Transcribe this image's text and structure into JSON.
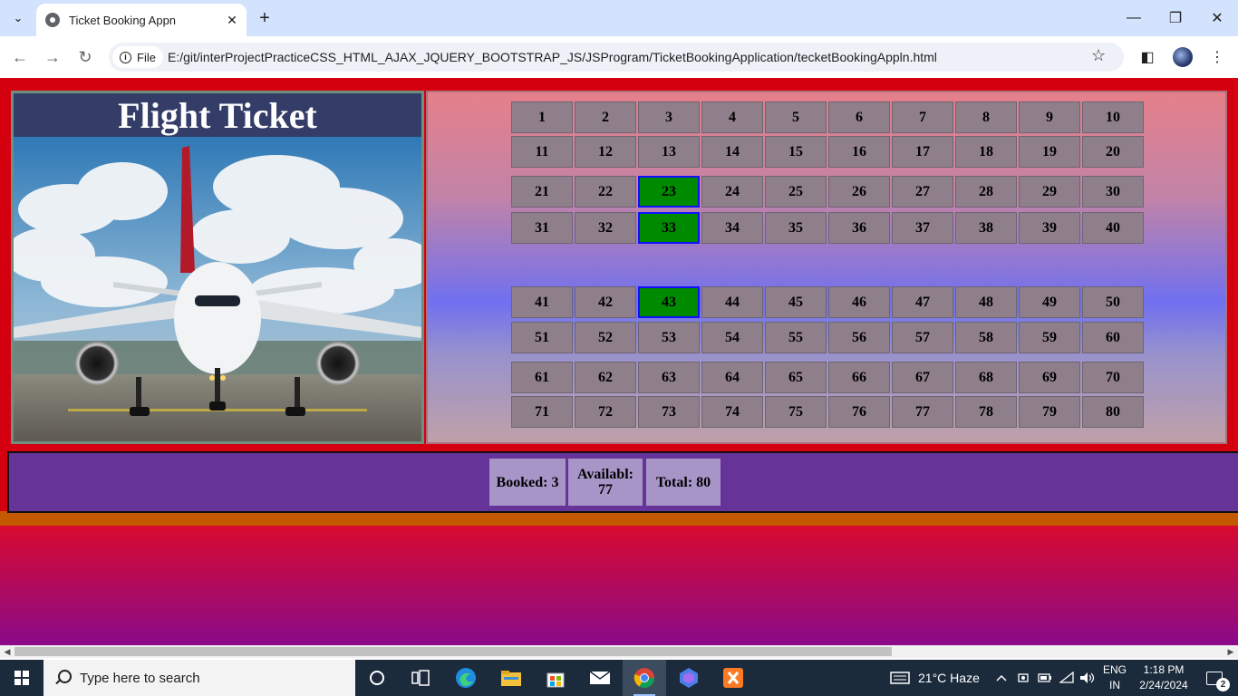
{
  "browser": {
    "tab_title": "Ticket Booking Appn",
    "url_chip": "File",
    "url": "E:/git/interProjectPracticeCSS_HTML_AJAX_JQUERY_BOOTSTRAP_JS/JSProgram/TicketBookingApplication/tecketBookingAppln.html",
    "icons": [
      "tab-search-icon",
      "close-icon",
      "plus-icon",
      "minimize-icon",
      "restore-icon",
      "close-window-icon",
      "back-icon",
      "forward-icon",
      "reload-icon",
      "info-icon",
      "star-icon",
      "side-panel-icon",
      "profile-avatar",
      "more-icon"
    ]
  },
  "app": {
    "title": "Flight Ticket",
    "image": "airplane on runway under cloudy sky",
    "seats": [
      {
        "num": "1",
        "booked": false
      },
      {
        "num": "2",
        "booked": false
      },
      {
        "num": "3",
        "booked": false
      },
      {
        "num": "4",
        "booked": false
      },
      {
        "num": "5",
        "booked": false
      },
      {
        "num": "6",
        "booked": false
      },
      {
        "num": "7",
        "booked": false
      },
      {
        "num": "8",
        "booked": false
      },
      {
        "num": "9",
        "booked": false
      },
      {
        "num": "10",
        "booked": false
      },
      {
        "num": "11",
        "booked": false
      },
      {
        "num": "12",
        "booked": false
      },
      {
        "num": "13",
        "booked": false
      },
      {
        "num": "14",
        "booked": false
      },
      {
        "num": "15",
        "booked": false
      },
      {
        "num": "16",
        "booked": false
      },
      {
        "num": "17",
        "booked": false
      },
      {
        "num": "18",
        "booked": false
      },
      {
        "num": "19",
        "booked": false
      },
      {
        "num": "20",
        "booked": false
      },
      {
        "num": "21",
        "booked": false
      },
      {
        "num": "22",
        "booked": false
      },
      {
        "num": "23",
        "booked": true
      },
      {
        "num": "24",
        "booked": false
      },
      {
        "num": "25",
        "booked": false
      },
      {
        "num": "26",
        "booked": false
      },
      {
        "num": "27",
        "booked": false
      },
      {
        "num": "28",
        "booked": false
      },
      {
        "num": "29",
        "booked": false
      },
      {
        "num": "30",
        "booked": false
      },
      {
        "num": "31",
        "booked": false
      },
      {
        "num": "32",
        "booked": false
      },
      {
        "num": "33",
        "booked": true
      },
      {
        "num": "34",
        "booked": false
      },
      {
        "num": "35",
        "booked": false
      },
      {
        "num": "36",
        "booked": false
      },
      {
        "num": "37",
        "booked": false
      },
      {
        "num": "38",
        "booked": false
      },
      {
        "num": "39",
        "booked": false
      },
      {
        "num": "40",
        "booked": false
      },
      {
        "num": "41",
        "booked": false
      },
      {
        "num": "42",
        "booked": false
      },
      {
        "num": "43",
        "booked": true
      },
      {
        "num": "44",
        "booked": false
      },
      {
        "num": "45",
        "booked": false
      },
      {
        "num": "46",
        "booked": false
      },
      {
        "num": "47",
        "booked": false
      },
      {
        "num": "48",
        "booked": false
      },
      {
        "num": "49",
        "booked": false
      },
      {
        "num": "50",
        "booked": false
      },
      {
        "num": "51",
        "booked": false
      },
      {
        "num": "52",
        "booked": false
      },
      {
        "num": "53",
        "booked": false
      },
      {
        "num": "54",
        "booked": false
      },
      {
        "num": "55",
        "booked": false
      },
      {
        "num": "56",
        "booked": false
      },
      {
        "num": "57",
        "booked": false
      },
      {
        "num": "58",
        "booked": false
      },
      {
        "num": "59",
        "booked": false
      },
      {
        "num": "60",
        "booked": false
      },
      {
        "num": "61",
        "booked": false
      },
      {
        "num": "62",
        "booked": false
      },
      {
        "num": "63",
        "booked": false
      },
      {
        "num": "64",
        "booked": false
      },
      {
        "num": "65",
        "booked": false
      },
      {
        "num": "66",
        "booked": false
      },
      {
        "num": "67",
        "booked": false
      },
      {
        "num": "68",
        "booked": false
      },
      {
        "num": "69",
        "booked": false
      },
      {
        "num": "70",
        "booked": false
      },
      {
        "num": "71",
        "booked": false
      },
      {
        "num": "72",
        "booked": false
      },
      {
        "num": "73",
        "booked": false
      },
      {
        "num": "74",
        "booked": false
      },
      {
        "num": "75",
        "booked": false
      },
      {
        "num": "76",
        "booked": false
      },
      {
        "num": "77",
        "booked": false
      },
      {
        "num": "78",
        "booked": false
      },
      {
        "num": "79",
        "booked": false
      },
      {
        "num": "80",
        "booked": false
      }
    ],
    "stats": {
      "booked": "Booked: 3",
      "available": "Availabl: 77",
      "total": "Total: 80"
    },
    "colors": {
      "booked_seat": "#008a00",
      "booked_seat_border": "#1010ff",
      "seat": "#8f7f8a",
      "stats_bar": "#663399",
      "stat_box": "#a795c8",
      "title_bg": "#343d67"
    }
  },
  "taskbar": {
    "search_placeholder": "Type here to search",
    "weather": "21°C  Haze",
    "language_line1": "ENG",
    "language_line2": "IN",
    "time": "1:18 PM",
    "date": "2/24/2024",
    "notification_count": "2",
    "icons": [
      "windows-start-icon",
      "search-icon",
      "cortana-icon",
      "task-view-icon",
      "edge-icon",
      "file-explorer-icon",
      "store-icon",
      "mail-icon",
      "chrome-icon",
      "copilot-icon",
      "xampp-icon",
      "weather-icon",
      "chevron-up-icon",
      "meet-icon",
      "battery-icon",
      "wifi-icon",
      "volume-icon",
      "notification-icon"
    ]
  }
}
